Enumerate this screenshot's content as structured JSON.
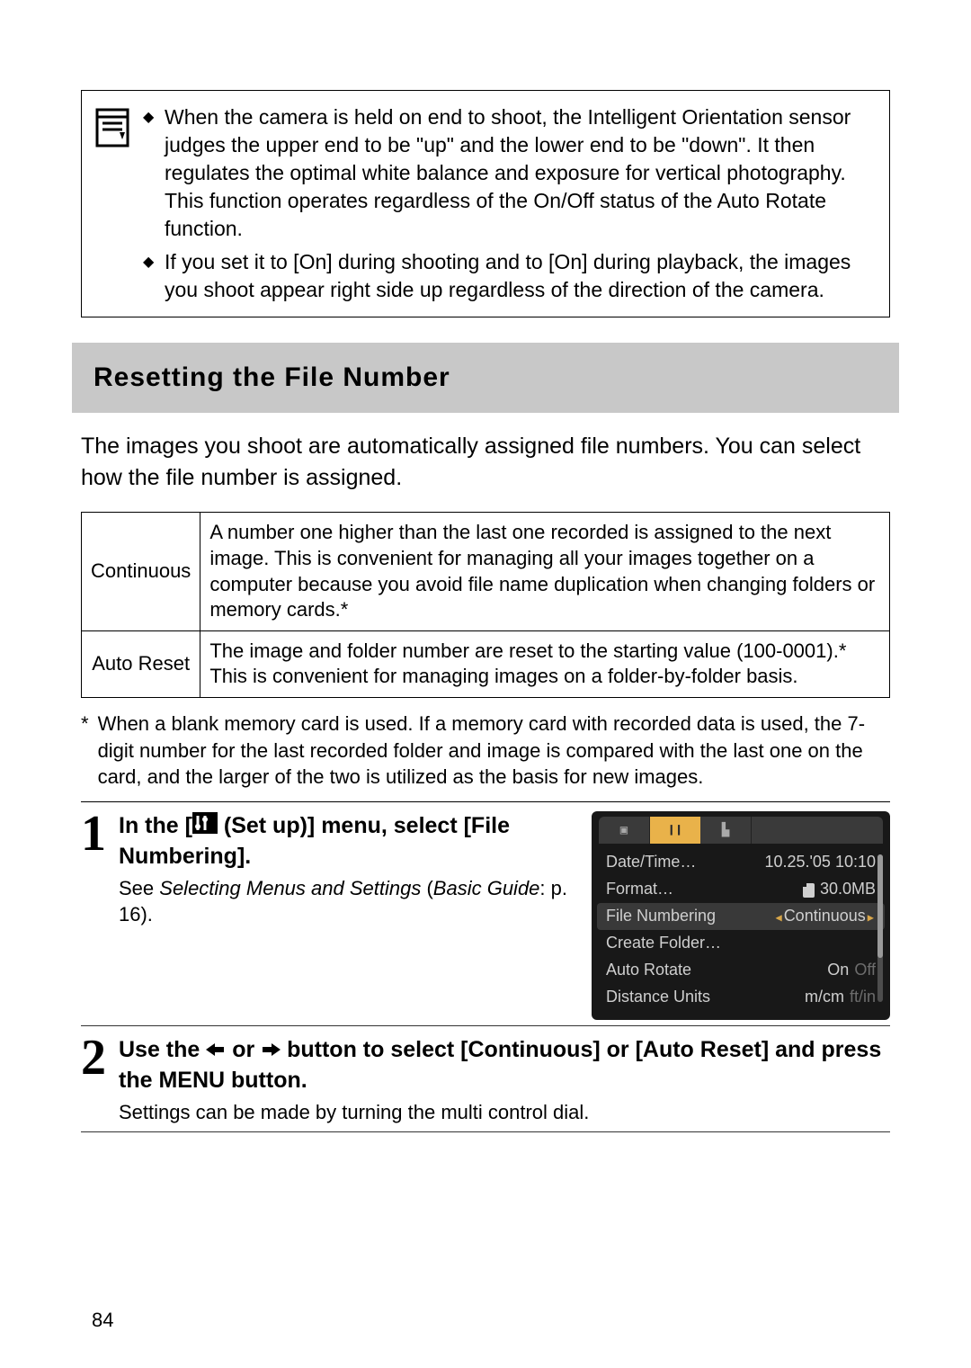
{
  "note": {
    "bullets": [
      "When the camera is held on end to shoot, the Intelligent Orientation sensor judges the upper end to be \"up\" and the lower end to be \"down\". It then regulates the optimal white balance and exposure for vertical photography. This function operates regardless of the On/Off status of the Auto Rotate function.",
      "If you set it to [On] during shooting and to [On] during playback, the images you shoot appear right side up regardless of the direction of the camera."
    ]
  },
  "section_title": "Resetting the File Number",
  "intro": "The images you shoot are automatically assigned file numbers. You can select how the file number is assigned.",
  "table": {
    "rows": [
      {
        "label": "Continuous",
        "desc": "A number one higher than the last one recorded is assigned to the next image. This is convenient for managing all your images together on a computer because you avoid file name duplication when changing folders or memory cards.*"
      },
      {
        "label": "Auto Reset",
        "desc": "The image and folder number are reset to the starting value (100-0001).* This is convenient for managing images on a folder-by-folder basis."
      }
    ]
  },
  "footnote_prefix": "*",
  "footnote": "When a blank memory card is used. If a memory card with recorded data is used, the 7-digit number for the last recorded folder and image is compared with the last one on the card, and the larger of the two is utilized as the basis for new images.",
  "step1": {
    "num": "1",
    "head_before": "In the [",
    "head_after": " (Set up)] menu, select [File Numbering].",
    "note_before": "See ",
    "note_italic": "Selecting Menus and Settings",
    "note_after_paren_open": " (",
    "note_italic2": "Basic Guide",
    "note_after": ": p. 16)."
  },
  "screen": {
    "rows": [
      {
        "k": "Date/Time…",
        "v": "10.25.'05 10:10"
      },
      {
        "k": "Format…",
        "v": "30.0MB"
      },
      {
        "k": "File Numbering",
        "v": "Continuous"
      },
      {
        "k": "Create Folder…",
        "v": ""
      },
      {
        "k": "Auto Rotate",
        "v_on": "On",
        "v_off": "Off"
      },
      {
        "k": "Distance Units",
        "v_on": "m/cm",
        "v_off": "ft/in"
      }
    ]
  },
  "step2": {
    "num": "2",
    "head_a": "Use the ",
    "head_b": " or ",
    "head_c": " button to select [Continuous] or [Auto Reset] and press the MENU button.",
    "note": "Settings can be made by turning the multi control dial."
  },
  "page_num": "84"
}
